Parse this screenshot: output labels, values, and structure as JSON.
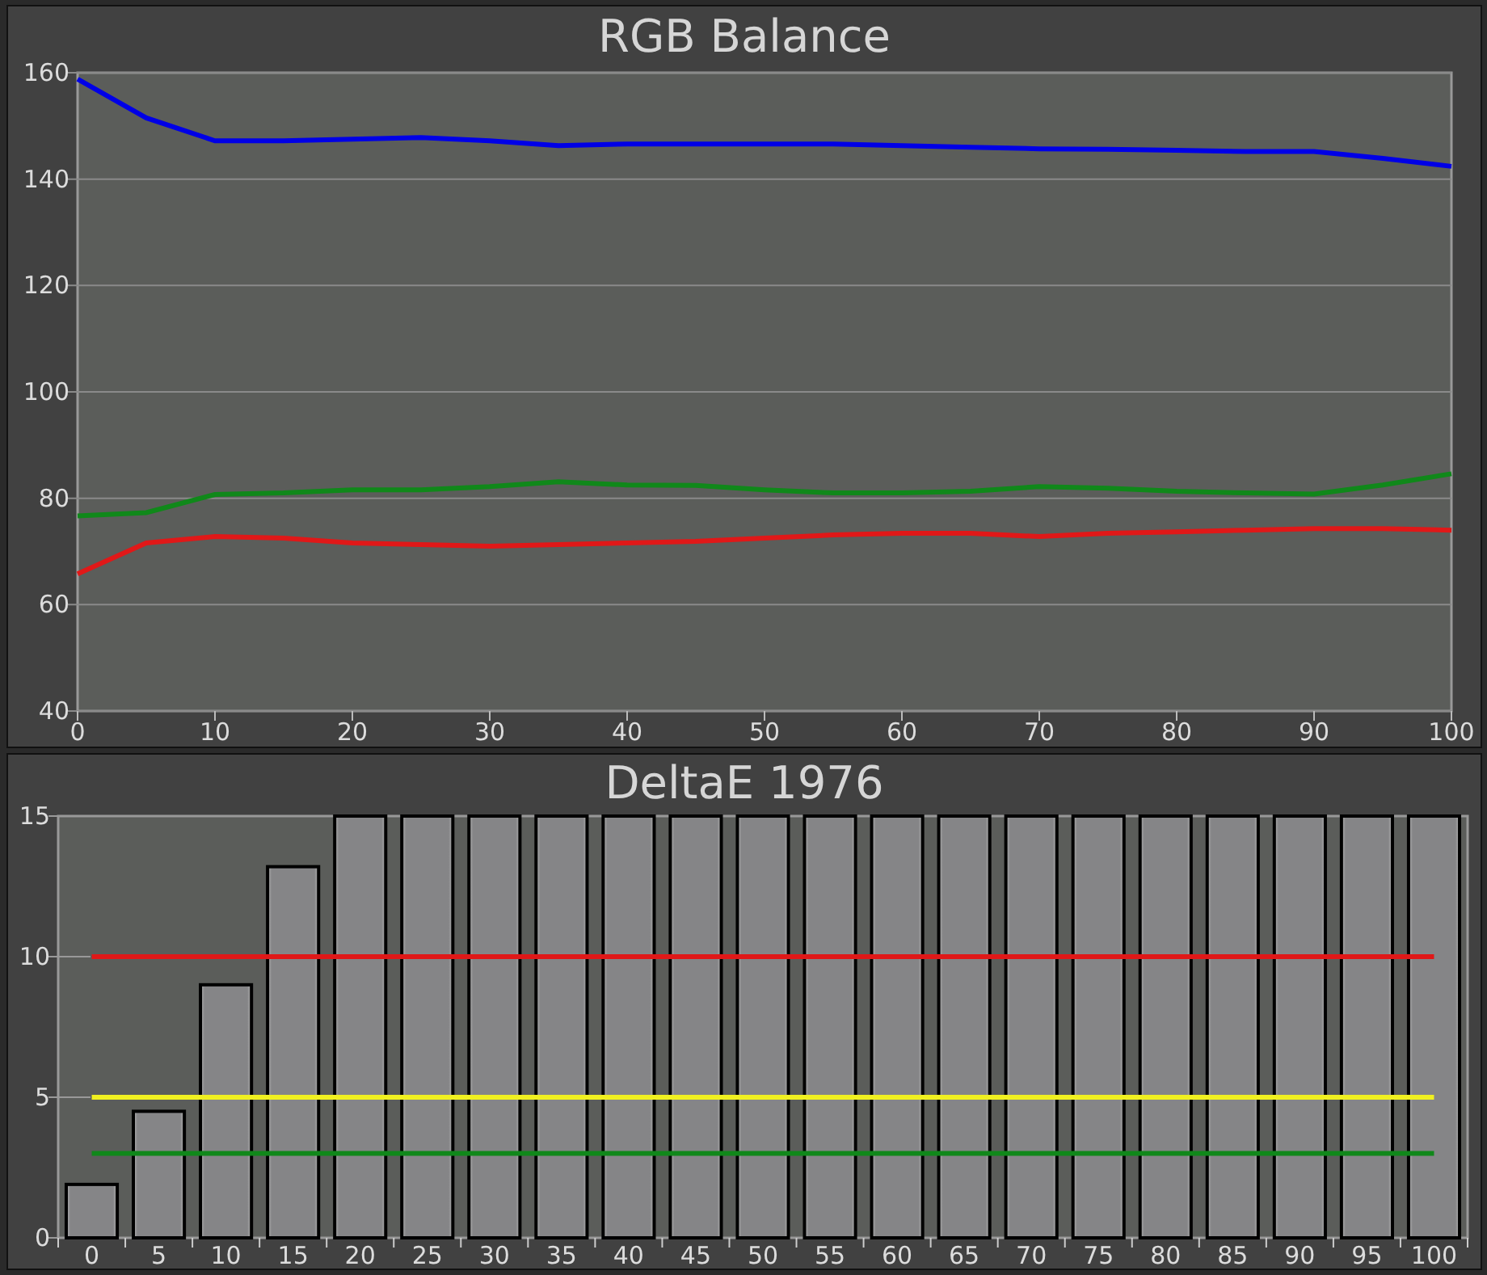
{
  "panels": [
    {
      "title": "RGB Balance",
      "chart_data": {
        "type": "line",
        "x": [
          0,
          5,
          10,
          15,
          20,
          25,
          30,
          35,
          40,
          45,
          50,
          55,
          60,
          65,
          70,
          75,
          80,
          85,
          90,
          95,
          100
        ],
        "xlim": [
          0,
          100
        ],
        "ylim": [
          40,
          160
        ],
        "xticks": [
          0,
          10,
          20,
          30,
          40,
          50,
          60,
          70,
          80,
          90,
          100
        ],
        "yticks": [
          40,
          60,
          80,
          100,
          120,
          140,
          160
        ],
        "grid": true,
        "series": [
          {
            "color": "#0000e6",
            "values": [
              158.8,
              151.5,
              147.2,
              147.2,
              147.5,
              147.8,
              147.2,
              146.3,
              146.6,
              146.6,
              146.6,
              146.6,
              146.3,
              146,
              145.7,
              145.6,
              145.4,
              145.2,
              145.2,
              143.9,
              142.4
            ]
          },
          {
            "color": "#10881a",
            "values": [
              76.7,
              77.3,
              80.7,
              81,
              81.6,
              81.6,
              82.2,
              83.1,
              82.5,
              82.4,
              81.6,
              81,
              81,
              81.3,
              82.2,
              81.9,
              81.3,
              81,
              80.8,
              82.5,
              84.6
            ]
          },
          {
            "color": "#e01818",
            "values": [
              65.8,
              71.6,
              72.8,
              72.5,
              71.6,
              71.3,
              71,
              71.3,
              71.6,
              71.9,
              72.5,
              73.1,
              73.4,
              73.4,
              72.8,
              73.4,
              73.7,
              74,
              74.3,
              74.3,
              74
            ]
          }
        ]
      }
    },
    {
      "title": "DeltaE 1976",
      "chart_data": {
        "type": "bar",
        "categories": [
          "0",
          "5",
          "10",
          "15",
          "20",
          "25",
          "30",
          "35",
          "40",
          "45",
          "50",
          "55",
          "60",
          "65",
          "70",
          "75",
          "80",
          "85",
          "90",
          "95",
          "100"
        ],
        "values": [
          1.9,
          4.5,
          9,
          13.2,
          15,
          15,
          15,
          15,
          15,
          15,
          15,
          15,
          15,
          15,
          15,
          15,
          15,
          15,
          15,
          15,
          15
        ],
        "ylim": [
          0,
          15
        ],
        "yticks": [
          0,
          5,
          10,
          15
        ],
        "ref_lines": [
          {
            "axis": "y",
            "value": 10,
            "color": "#e01818"
          },
          {
            "axis": "y",
            "value": 5,
            "color": "#f0f020"
          },
          {
            "axis": "y",
            "value": 3,
            "color": "#10881a"
          }
        ]
      }
    }
  ]
}
